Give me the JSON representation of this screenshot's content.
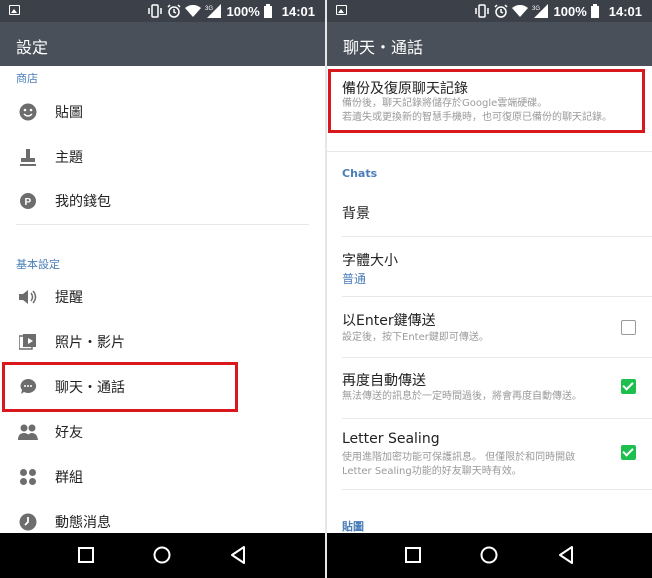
{
  "status": {
    "battery_pct": "100%",
    "time": "14:01",
    "network": "3G"
  },
  "left": {
    "title": "設定",
    "sections": [
      {
        "header": "商店",
        "items": [
          {
            "label": "貼圖",
            "icon": "smiley-icon"
          },
          {
            "label": "主題",
            "icon": "stamp-icon"
          },
          {
            "label": "我的錢包",
            "icon": "wallet-p-icon"
          }
        ]
      },
      {
        "header": "基本設定",
        "items": [
          {
            "label": "提醒",
            "icon": "speaker-icon"
          },
          {
            "label": "照片・影片",
            "icon": "media-icon"
          },
          {
            "label": "聊天・通話",
            "icon": "chat-bubble-icon"
          },
          {
            "label": "好友",
            "icon": "friends-icon"
          },
          {
            "label": "群組",
            "icon": "groups-icon"
          },
          {
            "label": "動態消息",
            "icon": "clock-icon"
          }
        ]
      }
    ]
  },
  "right": {
    "title": "聊天・通話",
    "backup": {
      "title": "備份及復原聊天記錄",
      "desc1": "備份後，聊天記錄將儲存於Google雲端硬碟。",
      "desc2": "若遺失或更換新的智慧手機時，也可復原已備份的聊天記錄。"
    },
    "chats_header": "Chats",
    "background_label": "背景",
    "font_size": {
      "title": "字體大小",
      "value": "普通"
    },
    "enter_send": {
      "title": "以Enter鍵傳送",
      "desc": "設定後，按下Enter鍵即可傳送。",
      "checked": false
    },
    "auto_resend": {
      "title": "再度自動傳送",
      "desc": "無法傳送的訊息於一定時間過後，將會再度自動傳送。",
      "checked": true
    },
    "letter_sealing": {
      "title": "Letter Sealing",
      "desc1": "使用進階加密功能可保護訊息。 但僅限於和同時開啟",
      "desc2": "Letter Sealing功能的好友聊天時有效。",
      "checked": true
    },
    "stickers_header": "貼圖"
  },
  "colors": {
    "accent_blue": "#4a7eb8",
    "highlight_red": "#d9181e",
    "check_green": "#1dbf4e",
    "appbar": "#4a5059"
  }
}
